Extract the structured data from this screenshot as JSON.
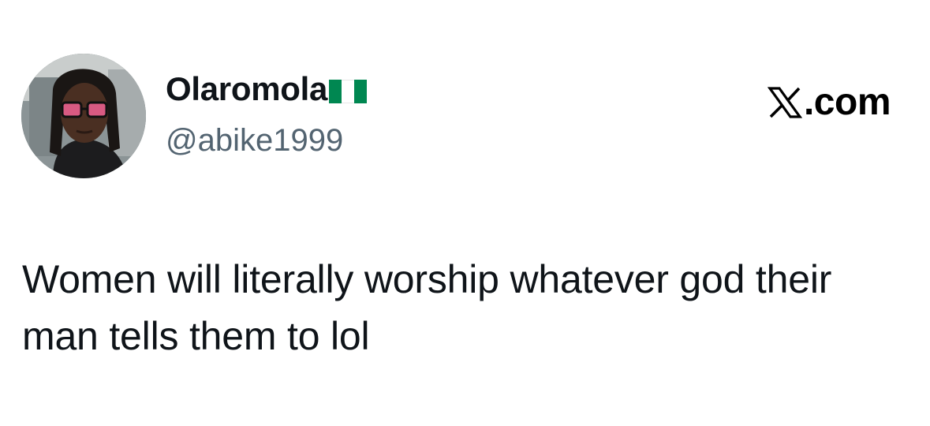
{
  "author": {
    "display_name": "Olaromola",
    "handle": "@abike1999",
    "flag_emoji": "nigeria-flag-icon"
  },
  "brand": {
    "text": ".com",
    "icon": "x-logo-icon"
  },
  "tweet": {
    "text": "Women will literally worship whatever god their man tells them to lol"
  },
  "colors": {
    "name": "#0f1419",
    "handle": "#536471",
    "flag_green": "#008751",
    "flag_white": "#ffffff"
  }
}
